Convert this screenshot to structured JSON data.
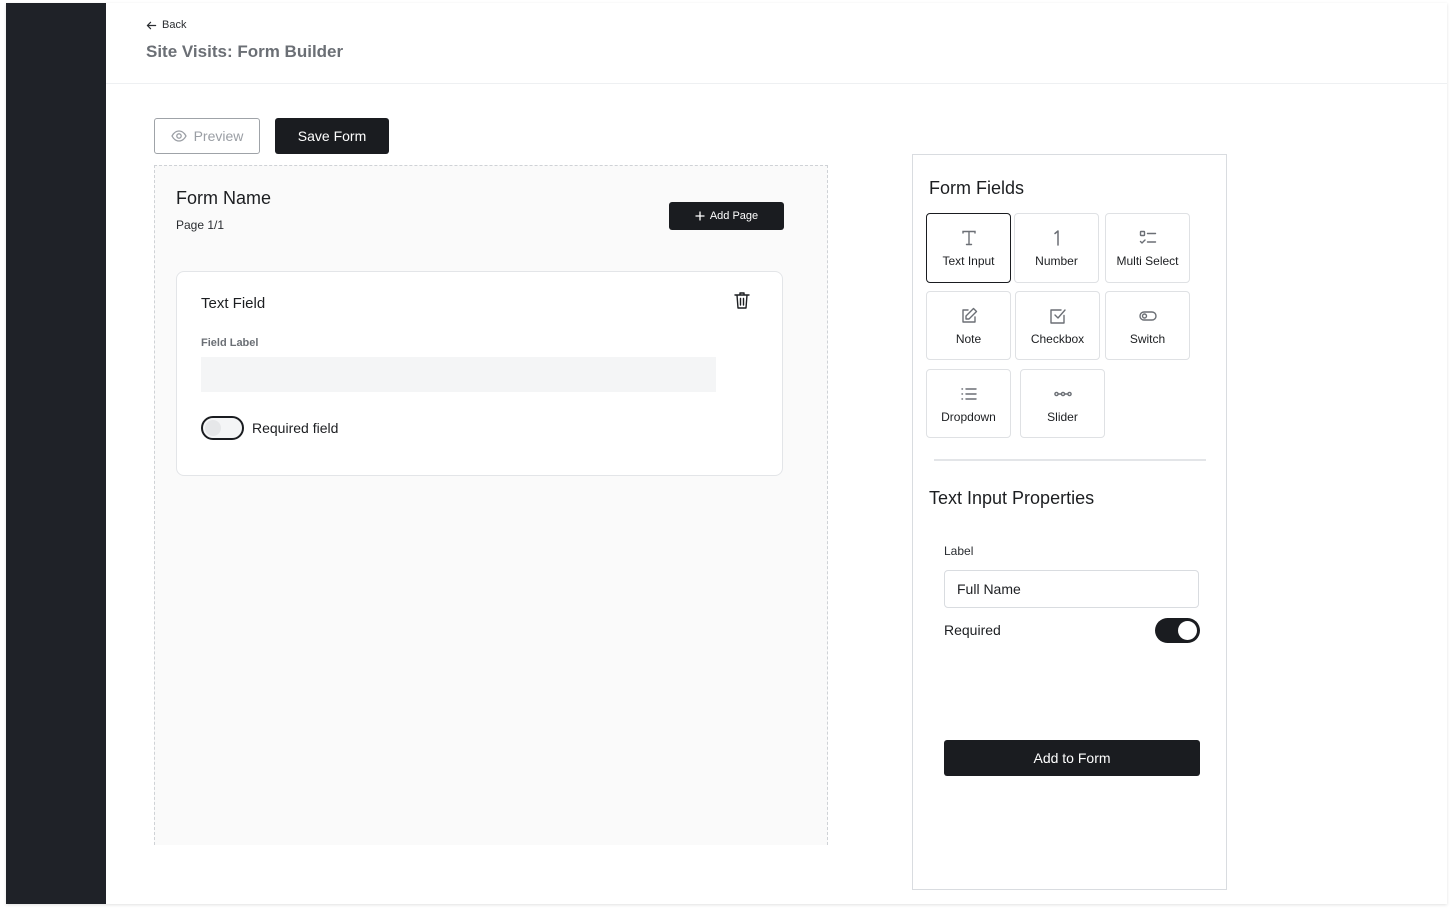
{
  "header": {
    "back_label": "Back",
    "title": "Site Visits: Form Builder"
  },
  "toolbar": {
    "preview_label": "Preview",
    "save_label": "Save Form"
  },
  "canvas": {
    "form_name": "Form Name",
    "page_indicator": "Page 1/1",
    "add_page_label": "Add Page",
    "field": {
      "title": "Text Field",
      "label_caption": "Field Label",
      "label_value": "",
      "required_label": "Required field",
      "required": false
    }
  },
  "panel": {
    "title": "Form Fields",
    "field_types": [
      {
        "label": "Text Input",
        "icon": "text-icon",
        "selected": true
      },
      {
        "label": "Number",
        "icon": "number-icon",
        "selected": false
      },
      {
        "label": "Multi Select",
        "icon": "list-check-icon",
        "selected": false
      },
      {
        "label": "Note",
        "icon": "edit-icon",
        "selected": false
      },
      {
        "label": "Checkbox",
        "icon": "checkbox-icon",
        "selected": false
      },
      {
        "label": "Switch",
        "icon": "toggle-icon",
        "selected": false
      },
      {
        "label": "Dropdown",
        "icon": "list-icon",
        "selected": false
      },
      {
        "label": "Slider",
        "icon": "slider-icon",
        "selected": false
      }
    ],
    "properties": {
      "title": "Text Input Properties",
      "label_caption": "Label",
      "label_value": "Full Name",
      "required_label": "Required",
      "required": true,
      "add_label": "Add to Form"
    }
  },
  "colors": {
    "sidebar": "#1f2228",
    "primary": "#1a1c20",
    "muted_text": "#6b6f75",
    "border": "#dfe1e4"
  }
}
